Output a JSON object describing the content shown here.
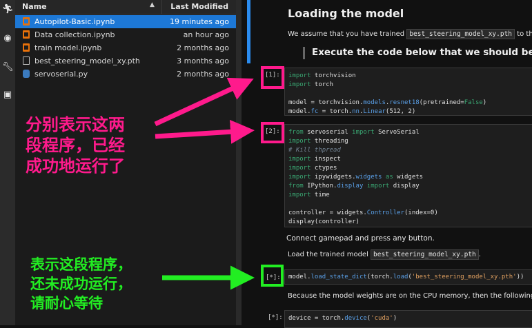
{
  "file_browser": {
    "header": {
      "name_label": "Name",
      "sort_icon": "sort-up-arrow",
      "modified_label": "Last Modified"
    },
    "files": [
      {
        "name": "Autopilot-Basic.ipynb",
        "modified": "19 minutes ago",
        "type": "notebook",
        "selected": true
      },
      {
        "name": "Data collection.ipynb",
        "modified": "an hour ago",
        "type": "notebook",
        "selected": false
      },
      {
        "name": "train model.ipynb",
        "modified": "2 months ago",
        "type": "notebook",
        "selected": false
      },
      {
        "name": "best_steering_model_xy.pth",
        "modified": "3 months ago",
        "type": "file",
        "selected": false
      },
      {
        "name": "servoserial.py",
        "modified": "2 months ago",
        "type": "python",
        "selected": false
      }
    ]
  },
  "notebook": {
    "heading": "Loading the model",
    "intro_text": "We assume that you have trained",
    "intro_code": "best_steering_model_xy.pth",
    "intro_tail": "to the",
    "quote": "Execute the code below that we should be fam",
    "cells": [
      {
        "prompt": "[1]:"
      },
      {
        "prompt": "[2]:"
      },
      {
        "prompt": "[*]:"
      },
      {
        "prompt": "[*]:"
      }
    ],
    "md_gamepad": "Connect gamepad and press any button.",
    "md_load_text": "Load the trained model",
    "md_load_code": "best_steering_model_xy.pth",
    "md_load_tail": ".",
    "md_cpu": "Because the model weights are on the CPU memory, then the following cod"
  },
  "annotations": {
    "pink_text": "分别表示这两\n段程序，已经\n成功地运行了",
    "green_text": "表示这段程序，\n还未成功运行，\n请耐心等待",
    "pink_color": "#ff1a8c",
    "green_color": "#22ee22"
  },
  "colors": {
    "accent": "#1d78d6",
    "notebook_icon": "#e8710a"
  }
}
